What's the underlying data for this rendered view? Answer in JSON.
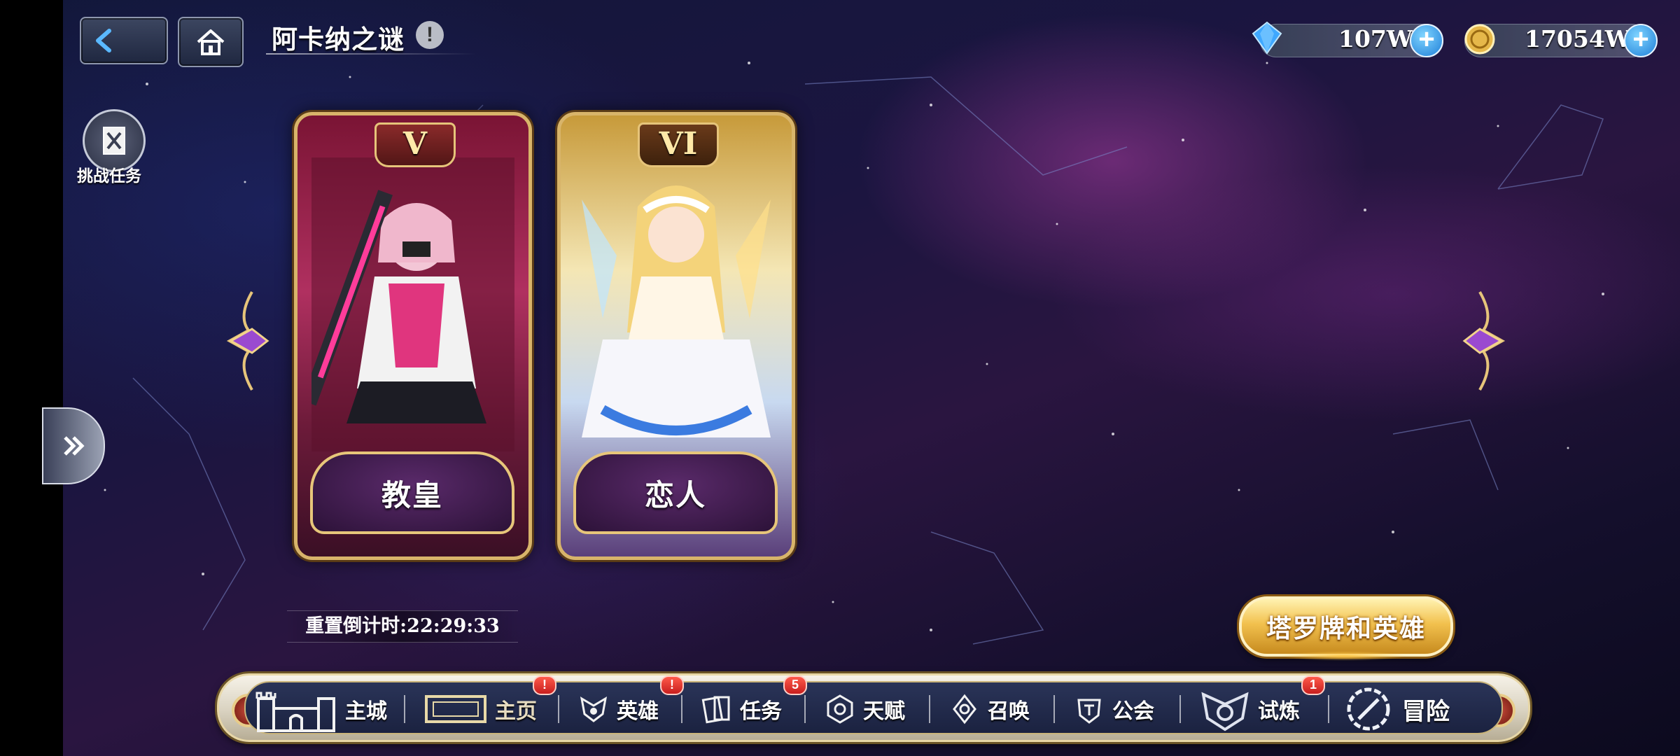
{
  "header": {
    "title": "阿卡纳之谜",
    "back_icon": "back-arrow-icon",
    "home_icon": "home-icon",
    "info_symbol": "!"
  },
  "currencies": [
    {
      "name": "diamond",
      "icon": "diamond-icon",
      "value": "107W",
      "color": "#3fa8ff"
    },
    {
      "name": "gold",
      "icon": "gold-coin-icon",
      "value": "17054W",
      "color": "#e6b84a"
    }
  ],
  "challenge_task": {
    "label": "挑战任务",
    "icon": "challenge-scroll-icon"
  },
  "cards": [
    {
      "numeral": "V",
      "name": "教皇",
      "accent": "#b03060"
    },
    {
      "numeral": "VI",
      "name": "恋人",
      "accent": "#e3c06a"
    }
  ],
  "countdown": {
    "text": "重置倒计时:22:29:33"
  },
  "tarot_button": {
    "label": "塔罗牌和英雄"
  },
  "nav": {
    "items": [
      {
        "label": "主城",
        "icon": "castle-icon",
        "badge": ""
      },
      {
        "label": "主页",
        "icon": "banner-icon",
        "badge": "!"
      },
      {
        "label": "英雄",
        "icon": "hero-icon",
        "badge": "!"
      },
      {
        "label": "任务",
        "icon": "task-icon",
        "badge": "5"
      },
      {
        "label": "天赋",
        "icon": "talent-icon",
        "badge": ""
      },
      {
        "label": "召唤",
        "icon": "summon-icon",
        "badge": ""
      },
      {
        "label": "公会",
        "icon": "guild-icon",
        "badge": ""
      },
      {
        "label": "试炼",
        "icon": "trial-icon",
        "badge": "1"
      },
      {
        "label": "冒险",
        "icon": "adventure-icon",
        "badge": ""
      }
    ]
  }
}
